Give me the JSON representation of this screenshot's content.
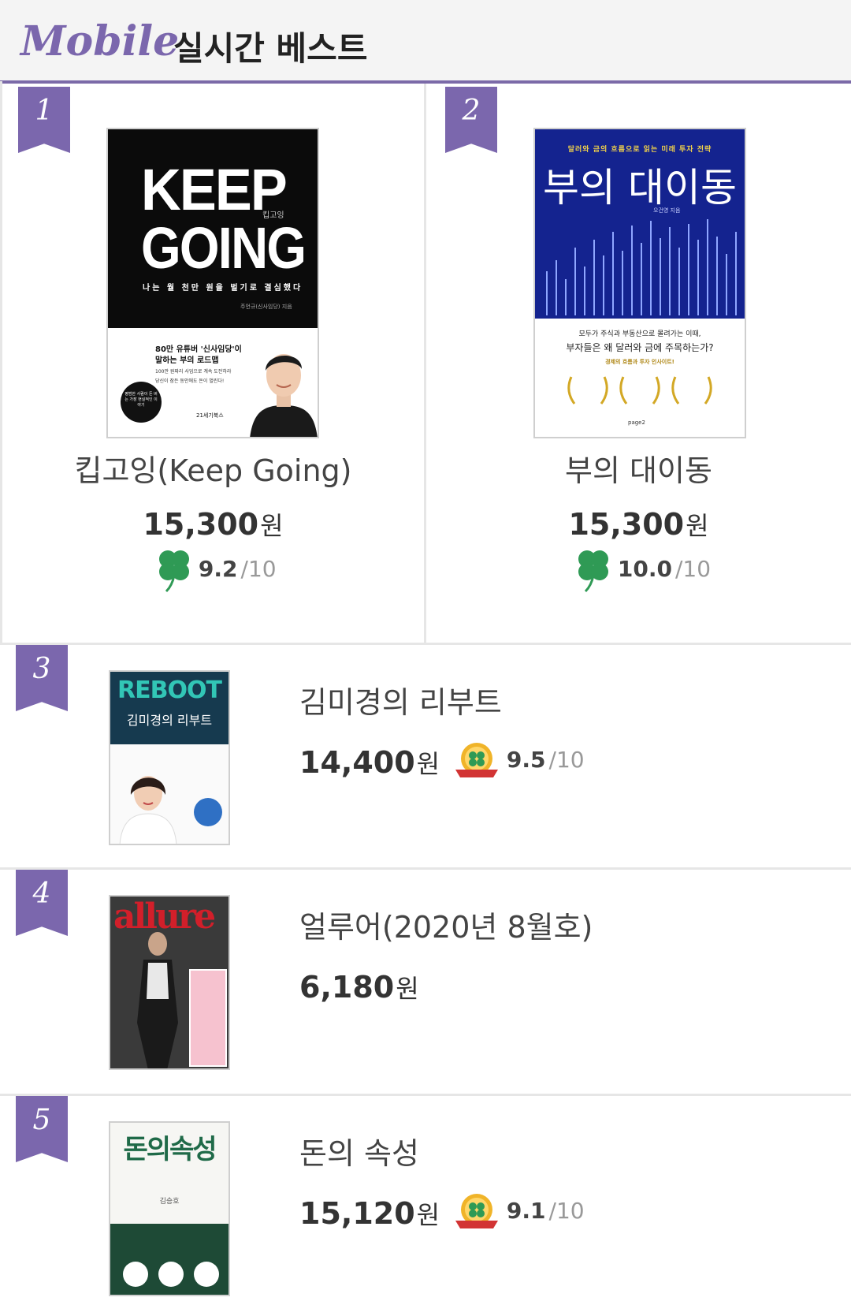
{
  "header": {
    "brand": "Mobile",
    "title": "실시간 베스트"
  },
  "colors": {
    "accent": "#7b67ad",
    "clover": "#2f9a55"
  },
  "items": [
    {
      "rank": "1",
      "title": "킵고잉(Keep Going)",
      "price": "15,300",
      "currency": "원",
      "score": "9.2",
      "score_max": "/10",
      "badge_icon": "clover-icon",
      "cover": {
        "line1": "KEEP",
        "line2": "GOING",
        "small": "킵고잉",
        "tagline": "나는 월 천만 원을 벌기로 결심했다",
        "author": "주언규(신사임당) 지음",
        "blurb1": "80만 유튜버 '신사임당'이",
        "blurb2": "말하는 부의 로드맵",
        "blurb3": "100만 원짜리 사업으로 계속 도전하라",
        "blurb4": "당신이 잠든 동안에도 돈이 벌린다!",
        "badge": "평범한 사람이 돈 버는 가장 현실적인 이야기",
        "publisher": "21세기북스"
      }
    },
    {
      "rank": "2",
      "title": "부의 대이동",
      "price": "15,300",
      "currency": "원",
      "score": "10.0",
      "score_max": "/10",
      "badge_icon": "clover-icon",
      "cover": {
        "kicker": "달러와 금의 흐름으로 읽는 미래 투자 전략",
        "headline": "부의 대이동",
        "author": "오건영 지음",
        "blurb1": "모두가 주식과 부동산으로 몰려가는 이때,",
        "blurb2": "부자들은 왜 달러와 금에 주목하는가?",
        "blurb3": "경제의 흐름과 투자 인사이트!",
        "publisher": "page2"
      }
    },
    {
      "rank": "3",
      "title": "김미경의 리부트",
      "price": "14,400",
      "currency": "원",
      "score": "9.5",
      "score_max": "/10",
      "badge_icon": "best-lucky-badge-icon",
      "cover": {
        "headline": "REBOOT",
        "sub": "김미경의 리부트"
      }
    },
    {
      "rank": "4",
      "title": "얼루어(2020년 8월호)",
      "price": "6,180",
      "currency": "원",
      "cover": {
        "headline": "allure"
      }
    },
    {
      "rank": "5",
      "title": "돈의 속성",
      "price": "15,120",
      "currency": "원",
      "score": "9.1",
      "score_max": "/10",
      "badge_icon": "best-lucky-badge-icon",
      "cover": {
        "headline": "돈의속성",
        "author": "김승호"
      }
    }
  ]
}
